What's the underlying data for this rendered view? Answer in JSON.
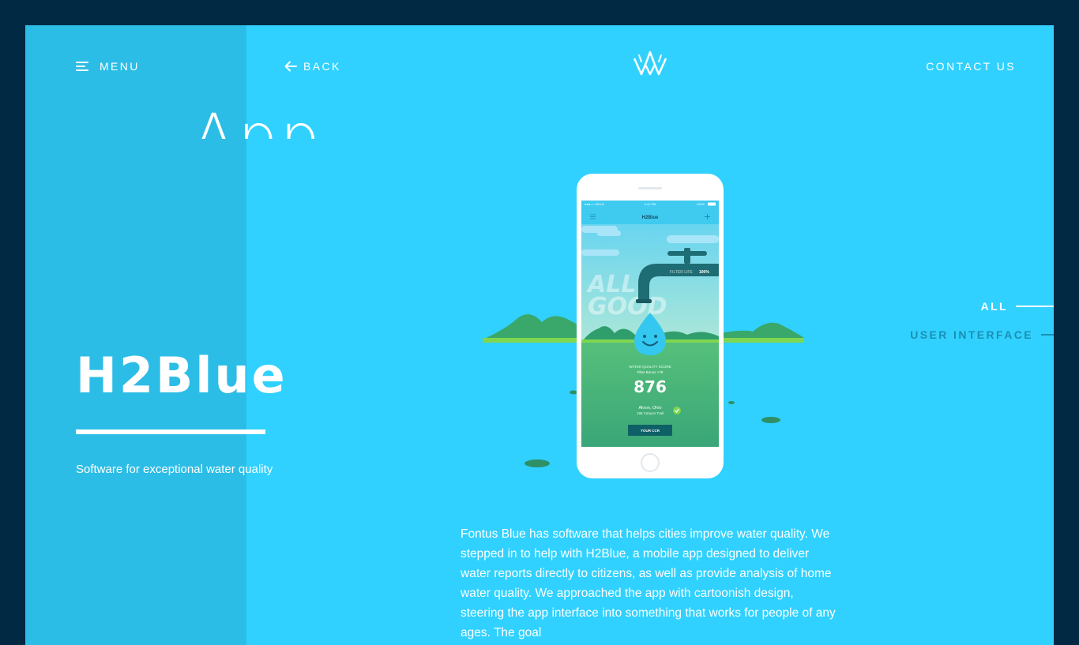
{
  "header": {
    "menu_label": "MENU",
    "back_label": "BACK",
    "contact_label": "CONTACT US"
  },
  "background_word": "App",
  "project": {
    "title": "H2Blue",
    "subtitle": "Software for exceptional water quality",
    "description": "Fontus Blue has software that helps cities improve water quality. We stepped in to help with H2Blue, a mobile app designed to deliver water reports directly to citizens, as well as provide analysis of home water quality. We approached the app with cartoonish design, steering the app interface into something that works for people of any ages. The goal"
  },
  "filters": [
    {
      "label": "ALL",
      "active": true
    },
    {
      "label": "USER INTERFACE",
      "active": false
    }
  ],
  "phone": {
    "carrier": "●●●○○ WKLN",
    "time": "9:41 PM",
    "battery": "100%",
    "app_title": "H2Blue",
    "watermark": "ALL GOOD",
    "filter_life_label": "FILTER LIFE",
    "filter_life_value": "100%",
    "score_label": "WATER QUALITY SCORE",
    "bonus_label": "Filter Bonus +78",
    "score_value": "876",
    "location": "Akron, Ohio",
    "address": "196 Canyon Trail",
    "cta_label": "YOUR CCR"
  },
  "colors": {
    "page_bg": "#022944",
    "frame_bg": "#30d1ff",
    "left_panel_bg": "#2cbde6",
    "inactive_filter": "#1b8fb3"
  },
  "icons": {
    "menu": "hamburger-icon",
    "back": "arrow-left-icon",
    "logo": "crown-logo-icon"
  }
}
